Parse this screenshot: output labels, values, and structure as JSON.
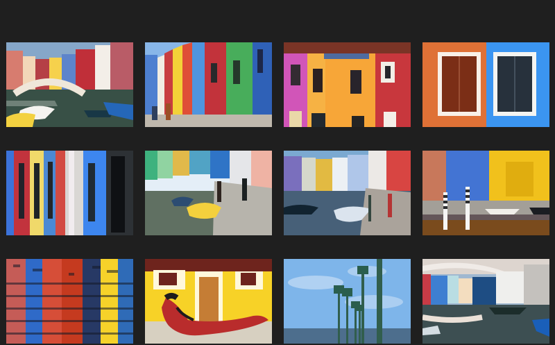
{
  "gallery": {
    "background": "#1f1f1f",
    "thumbnails": [
      {
        "id": "burano-bridge-canal-boats"
      },
      {
        "id": "burano-street-colored-houses"
      },
      {
        "id": "burano-painted-facades-balconies"
      },
      {
        "id": "burano-windows-orange-blue"
      },
      {
        "id": "burano-striped-facades"
      },
      {
        "id": "burano-canal-yellow-boat"
      },
      {
        "id": "burano-canal-boats-reflection"
      },
      {
        "id": "burano-blue-yellow-mooring-poles"
      },
      {
        "id": "burano-canal-reflections"
      },
      {
        "id": "burano-yellow-house-red-boat"
      },
      {
        "id": "burano-lamp-posts-sky"
      },
      {
        "id": "burano-bridge-reflection"
      }
    ]
  }
}
